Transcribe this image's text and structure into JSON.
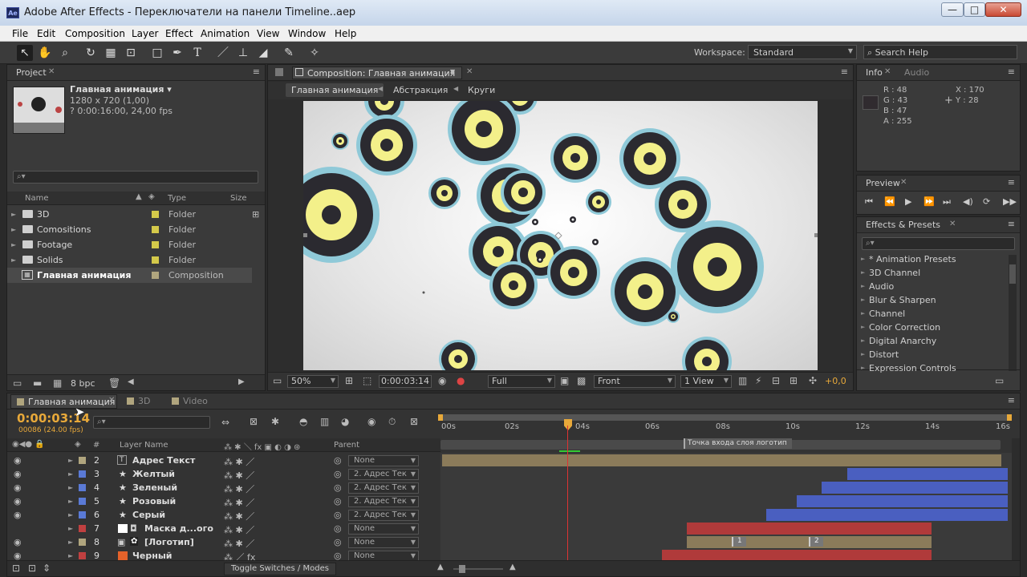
{
  "window": {
    "title": "Adobe After Effects - Переключатели на панели Timeline..aep",
    "app_badge": "Ae"
  },
  "window_controls": {
    "minimize": "—",
    "maximize": "□",
    "close": "✕"
  },
  "menu": [
    "File",
    "Edit",
    "Composition",
    "Layer",
    "Effect",
    "Animation",
    "View",
    "Window",
    "Help"
  ],
  "toolbar": {
    "workspace_label": "Workspace:",
    "workspace_value": "Standard",
    "search_help": "Search Help"
  },
  "project": {
    "tab": "Project",
    "comp_name": "Главная анимация ▾",
    "comp_size": "1280 x 720 (1,00)",
    "comp_duration": "? 0:00:16:00, 24,00 fps",
    "col_name": "Name",
    "col_type": "Type",
    "col_size": "Size",
    "items": [
      {
        "name": "3D",
        "type": "Folder",
        "color": "#d4c94a"
      },
      {
        "name": "Comositions",
        "type": "Folder",
        "color": "#d4c94a"
      },
      {
        "name": "Footage",
        "type": "Folder",
        "color": "#d4c94a"
      },
      {
        "name": "Solids",
        "type": "Folder",
        "color": "#d4c94a"
      },
      {
        "name": "Главная анимация",
        "type": "Composition",
        "color": "#b0a57e"
      }
    ],
    "bpc": "8 bpc"
  },
  "composition": {
    "tab": "Composition: Главная анимация",
    "breadcrumbs": [
      "Главная анимация",
      "Абстракция",
      "Круги"
    ],
    "zoom": "50%",
    "timecode": "0:00:03:14",
    "resolution": "Full",
    "view": "Front",
    "views": "1 View",
    "exposure": "+0,0"
  },
  "info": {
    "tab": "Info",
    "tab2": "Audio",
    "r": "R : 48",
    "g": "G : 43",
    "b": "B : 47",
    "a": "A : 255",
    "x": "X : 170",
    "y": "Y : 28"
  },
  "preview": {
    "tab": "Preview"
  },
  "effects": {
    "tab": "Effects & Presets",
    "items": [
      "* Animation Presets",
      "3D Channel",
      "Audio",
      "Blur & Sharpen",
      "Channel",
      "Color Correction",
      "Digital Anarchy",
      "Distort",
      "Expression Controls"
    ]
  },
  "timeline": {
    "tabs": [
      "Главная анимация",
      "3D",
      "Video"
    ],
    "timecode": "0:00:03:14",
    "frame_info": "00086 (24.00 fps)",
    "col_layer_name": "Layer Name",
    "col_parent": "Parent",
    "col_num": "#",
    "toggle_label": "Toggle Switches / Modes",
    "ruler": [
      "00s",
      "02s",
      "04s",
      "06s",
      "08s",
      "10s",
      "12s",
      "14s",
      "16s"
    ],
    "marker_label": "Точка входа слоя логотип",
    "keyframe_labels": [
      "1",
      "2"
    ],
    "layers": [
      {
        "num": "2",
        "name": "Адрес Текст",
        "color": "#b0a57e",
        "parent": "None",
        "icon": "T"
      },
      {
        "num": "3",
        "name": "Желтый",
        "color": "#5a7ad6",
        "parent": "2. Адрес Тек",
        "icon": "★"
      },
      {
        "num": "4",
        "name": "Зеленый",
        "color": "#5a7ad6",
        "parent": "2. Адрес Тек",
        "icon": "★"
      },
      {
        "num": "5",
        "name": "Розовый",
        "color": "#5a7ad6",
        "parent": "2. Адрес Тек",
        "icon": "★"
      },
      {
        "num": "6",
        "name": "Серый",
        "color": "#5a7ad6",
        "parent": "2. Адрес Тек",
        "icon": "★"
      },
      {
        "num": "7",
        "name": "Маска д...ого",
        "color": "#c04040",
        "parent": "None",
        "icon": "□"
      },
      {
        "num": "8",
        "name": "[Логотип]",
        "color": "#b0a57e",
        "parent": "None",
        "icon": "▣"
      },
      {
        "num": "9",
        "name": "Черный",
        "color": "#c04040",
        "parent": "None",
        "icon": "■"
      }
    ]
  }
}
